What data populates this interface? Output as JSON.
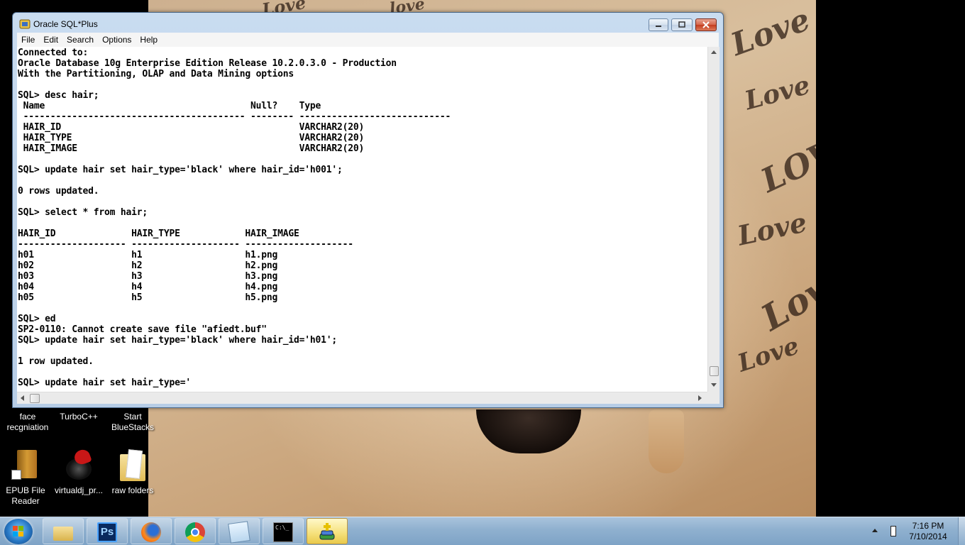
{
  "window": {
    "title": "Oracle SQL*Plus",
    "menu": [
      "File",
      "Edit",
      "Search",
      "Options",
      "Help"
    ],
    "console_lines": [
      "Connected to:",
      "Oracle Database 10g Enterprise Edition Release 10.2.0.3.0 - Production",
      "With the Partitioning, OLAP and Data Mining options",
      "",
      "SQL> desc hair;",
      " Name                                      Null?    Type",
      " ----------------------------------------- -------- ----------------------------",
      " HAIR_ID                                            VARCHAR2(20)",
      " HAIR_TYPE                                          VARCHAR2(20)",
      " HAIR_IMAGE                                         VARCHAR2(20)",
      "",
      "SQL> update hair set hair_type='black' where hair_id='h001';",
      "",
      "0 rows updated.",
      "",
      "SQL> select * from hair;",
      "",
      "HAIR_ID              HAIR_TYPE            HAIR_IMAGE",
      "-------------------- -------------------- --------------------",
      "h01                  h1                   h1.png",
      "h02                  h2                   h2.png",
      "h03                  h3                   h3.png",
      "h04                  h4                   h4.png",
      "h05                  h5                   h5.png",
      "",
      "SQL> ed",
      "SP2-0110: Cannot create save file \"afiedt.buf\"",
      "SQL> update hair set hair_type='black' where hair_id='h01';",
      "",
      "1 row updated.",
      "",
      "SQL> update hair set hair_type='"
    ]
  },
  "desktop_icons": [
    {
      "label": "face\nrecgniation",
      "icon": "folder-icon"
    },
    {
      "label": "TurboC++",
      "icon": "app-icon"
    },
    {
      "label": "Start\nBlueStacks",
      "icon": "bluestacks-icon"
    },
    {
      "label": "EPUB File\nReader",
      "icon": "book-shortcut-icon"
    },
    {
      "label": "virtualdj_pr...",
      "icon": "virtualdj-icon"
    },
    {
      "label": "raw folders",
      "icon": "folder-icon"
    }
  ],
  "taskbar": {
    "buttons": [
      "explorer",
      "photoshop",
      "firefox",
      "chrome",
      "notepad",
      "cmd",
      "sqlplus"
    ],
    "ps_label": "Ps",
    "cmd_label": "C:\\_",
    "time": "7:16 PM",
    "date": "7/10/2014"
  },
  "colors": {
    "taskbar": "#8fb0cf",
    "window_frame": "#b7cde6",
    "console_bg": "#ffffff",
    "console_text": "#000000"
  }
}
